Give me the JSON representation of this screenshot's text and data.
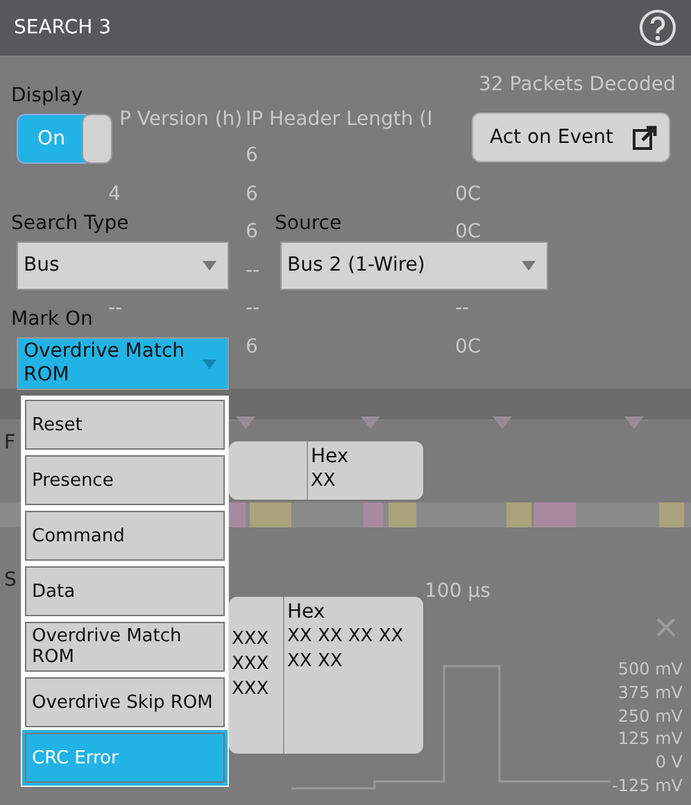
{
  "window": {
    "title": "SEARCH 3"
  },
  "background": {
    "packets": "32 Packets Decoded",
    "table": {
      "columns": [
        "P Version (h)",
        "IP Header Length (I"
      ],
      "rows": [
        {
          "column_2": "6"
        },
        {
          "column_1": "4",
          "column_2": "6",
          "column_3": "0C"
        },
        {
          "column_2": "6",
          "column_3": "0C"
        },
        {
          "column_2": "--"
        },
        {
          "column_1": "--",
          "column_2": "--",
          "column_3": "--"
        },
        {
          "column_2": "6",
          "column_3": "0C"
        }
      ]
    },
    "hidden_labels": [
      "F",
      "S"
    ],
    "time_label": "100 µs",
    "axis_labels": [
      "500 mV",
      "375 mV",
      "250 mV",
      "125 mV",
      "0 V",
      "-125 mV"
    ]
  },
  "display": {
    "label": "Display",
    "toggle": {
      "text": "On",
      "on": true
    }
  },
  "act_button": {
    "label": "Act on Event"
  },
  "search_type": {
    "label": "Search Type",
    "value": "Bus"
  },
  "source": {
    "label": "Source",
    "value": "Bus 2 (1-Wire)"
  },
  "mark_on": {
    "label": "Mark On",
    "value": "Overdrive Match ROM",
    "expanded": true,
    "options": [
      {
        "label": "Reset",
        "highlighted": false
      },
      {
        "label": "Presence",
        "highlighted": false
      },
      {
        "label": "Command",
        "highlighted": false
      },
      {
        "label": "Data",
        "highlighted": false
      },
      {
        "label": "Overdrive Match ROM",
        "highlighted": false
      },
      {
        "label": "Overdrive Skip ROM",
        "highlighted": false
      },
      {
        "label": "CRC Error",
        "highlighted": true
      }
    ]
  },
  "decode_results": [
    {
      "hex_label": "Hex",
      "hex_lines": [
        "XX"
      ]
    },
    {
      "data_lines": [
        "XXX",
        "XXX",
        "XXX"
      ],
      "hex_label": "Hex",
      "hex_lines": [
        "XX XX XX XX",
        "XX XX"
      ]
    }
  ]
}
